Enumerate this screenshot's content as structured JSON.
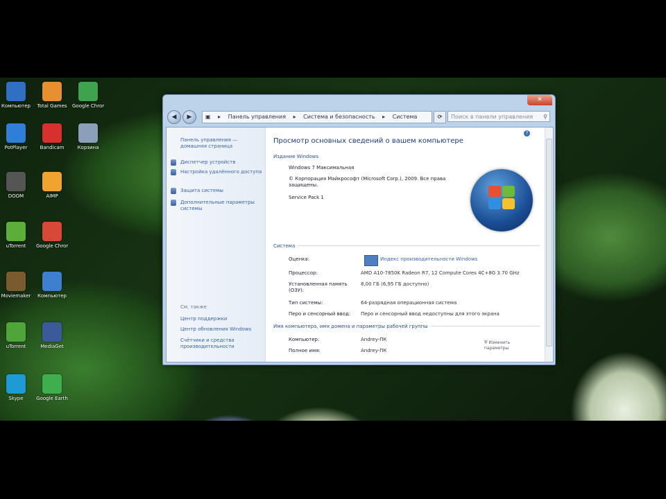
{
  "desktop": {
    "icons": [
      {
        "label": "Компьютер",
        "color": "#2f6fc4"
      },
      {
        "label": "Total Games",
        "color": "#e8902f"
      },
      {
        "label": "Google Chrome",
        "color": "#3fa34d"
      },
      {
        "label": "PotPlayer",
        "color": "#2f7ed8"
      },
      {
        "label": "Bandicam",
        "color": "#d8302f"
      },
      {
        "label": "Корзина",
        "color": "#8aa0b8"
      },
      {
        "label": "DOOM",
        "color": "#555555"
      },
      {
        "label": "AIMP",
        "color": "#f0a32f"
      },
      {
        "label": "uTorrent",
        "color": "#5cad3a"
      },
      {
        "label": "Google Chrome",
        "color": "#d84836"
      },
      {
        "label": "Moviemaker",
        "color": "#7a5a2f"
      },
      {
        "label": "Компьютер",
        "color": "#3f7fd0"
      },
      {
        "label": "uTorrent",
        "color": "#4fa53a"
      },
      {
        "label": "MediaGet",
        "color": "#3a5a9a"
      },
      {
        "label": "Skype",
        "color": "#1e9ad6"
      },
      {
        "label": "Google Earth",
        "color": "#3fae4f"
      }
    ]
  },
  "window": {
    "close_label": "✕",
    "address": [
      "Панель управления",
      "Система и безопасность",
      "Система"
    ],
    "search_placeholder": "Поиск в панели управления",
    "left_pane": {
      "home_link": "Панель управления — домашняя страница",
      "links": [
        "Диспетчер устройств",
        "Настройка удалённого доступа",
        "Защита системы",
        "Дополнительные параметры системы"
      ],
      "see_also_head": "См. также",
      "see_also": [
        "Центр поддержки",
        "Центр обновления Windows",
        "Счётчики и средства производительности"
      ]
    },
    "main": {
      "title": "Просмотр основных сведений о вашем компьютере",
      "edition_head": "Издание Windows",
      "edition": "Windows 7 Максимальная",
      "copyright": "© Корпорация Майкрософт (Microsoft Corp.), 2009. Все права защищены.",
      "service_pack": "Service Pack 1",
      "system_head": "Система",
      "rows": [
        {
          "k": "Оценка:",
          "v": "Индекс производительности Windows"
        },
        {
          "k": "Процессор:",
          "v": "AMD A10-7850K Radeon R7, 12 Compute Cores 4C+8G  3.70 GHz"
        },
        {
          "k": "Установленная память (ОЗУ):",
          "v": "8,00 ГБ (6,95 ГБ доступно)"
        },
        {
          "k": "Тип системы:",
          "v": "64-разрядная операционная система"
        },
        {
          "k": "Перо и сенсорный ввод:",
          "v": "Перо и сенсорный ввод недоступны для этого экрана"
        }
      ],
      "name_head": "Имя компьютера, имя домена и параметры рабочей группы",
      "name_rows": [
        {
          "k": "Компьютер:",
          "v": "Andrey-ПК"
        },
        {
          "k": "Полное имя:",
          "v": "Andrey-ПК"
        }
      ],
      "change_link": "Изменить параметры"
    }
  }
}
